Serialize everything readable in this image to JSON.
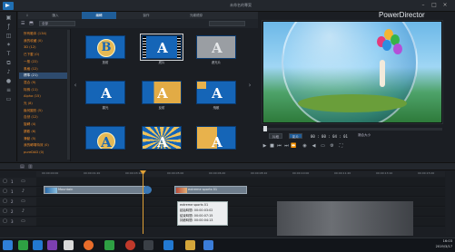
{
  "app": {
    "window_title": "未命名的專案",
    "brand": "PowerDirector"
  },
  "room_tabs": [
    {
      "label": "匯入",
      "active": false
    },
    {
      "label": "編輯",
      "active": true
    },
    {
      "label": "製作",
      "active": false
    },
    {
      "label": "光碟燒錄",
      "active": false
    }
  ],
  "library": {
    "filter_label": "全部",
    "categories": [
      {
        "label": "所有範本 (134)",
        "selected": false
      },
      {
        "label": "我的收藏 (0)",
        "selected": false
      },
      {
        "label": "3D (12)",
        "selected": false
      },
      {
        "label": "已下載 (0)",
        "selected": false
      },
      {
        "label": "一般 (22)",
        "selected": false
      },
      {
        "label": "風格 (12)",
        "selected": false
      },
      {
        "label": "標準 (21)",
        "selected": true
      },
      {
        "label": "混合 (9)",
        "selected": false
      },
      {
        "label": "特殊 (11)",
        "selected": false
      },
      {
        "label": "Alpha (15)",
        "selected": false
      },
      {
        "label": "光 (8)",
        "selected": false
      },
      {
        "label": "幾何圖形 (5)",
        "selected": false
      },
      {
        "label": "自然 (12)",
        "selected": false
      },
      {
        "label": "旋轉 (4)",
        "selected": false
      },
      {
        "label": "擴散 (6)",
        "selected": false
      },
      {
        "label": "滑動 (5)",
        "selected": false
      },
      {
        "label": "我的轉場特效 (0)",
        "selected": false
      },
      {
        "label": "pureDAD (0)",
        "selected": false
      }
    ],
    "thumbnails": [
      {
        "caption": "放射",
        "icon": "letter-b-circle-thumb",
        "selected": false
      },
      {
        "caption": "底片",
        "icon": "film-strip-thumb",
        "selected": true
      },
      {
        "caption": "遮光片",
        "icon": "gray-letter-a-thumb",
        "selected": false
      },
      {
        "caption": "擴光",
        "icon": "letter-a-thumb",
        "selected": false
      },
      {
        "caption": "反射",
        "icon": "letter-a-gold-thumb",
        "selected": false
      },
      {
        "caption": "飛散",
        "icon": "letter-a-corner-thumb",
        "selected": false
      },
      {
        "caption": "",
        "icon": "gold-arch-thumb",
        "selected": false
      },
      {
        "caption": "",
        "icon": "rays-thumb",
        "selected": false
      },
      {
        "caption": "",
        "icon": "split-thumb",
        "selected": false
      }
    ]
  },
  "player": {
    "mode_clip": "片段",
    "mode_movie": "影片",
    "timecode": "00 : 00 : 04 : 01",
    "zoom_label": "適合大小"
  },
  "timeline": {
    "ruler": [
      "00:00:00:00",
      "00:00:01:20",
      "00:00:03:10",
      "00:00:05:00",
      "00:00:06:20",
      "00:00:08:10",
      "00:00:10:00",
      "00:00:11:20",
      "00:00:13:10",
      "00:00:15:00"
    ],
    "tracks": [
      "1",
      "1",
      "2",
      "2",
      "3"
    ],
    "clips": [
      {
        "label": "Mountain"
      },
      {
        "label": "extreme sports 01"
      }
    ],
    "tooltip": [
      "extreme sports 01",
      "起始時間: 00:00:03:02",
      "結束時間: 00:00:07:15",
      "持續時間: 00:00:04:13"
    ]
  },
  "taskbar": {
    "time": "16:03",
    "date": "2019/3/17"
  }
}
